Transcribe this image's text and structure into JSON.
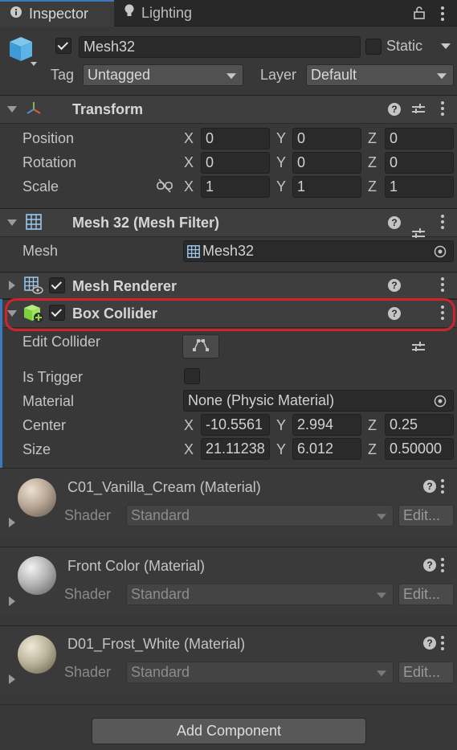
{
  "tabs": [
    {
      "label": "Inspector",
      "icon": "info-icon"
    },
    {
      "label": "Lighting",
      "icon": "bulb-icon"
    }
  ],
  "object": {
    "name": "Mesh32",
    "active": true,
    "static_label": "Static",
    "static_checked": false,
    "tag_label": "Tag",
    "tag_value": "Untagged",
    "layer_label": "Layer",
    "layer_value": "Default"
  },
  "transform": {
    "title": "Transform",
    "rows": [
      {
        "label": "Position",
        "x": "0",
        "y": "0",
        "z": "0"
      },
      {
        "label": "Rotation",
        "x": "0",
        "y": "0",
        "z": "0"
      },
      {
        "label": "Scale",
        "x": "1",
        "y": "1",
        "z": "1"
      }
    ]
  },
  "mesh_filter": {
    "title": "Mesh 32 (Mesh Filter)",
    "mesh_label": "Mesh",
    "mesh_value": "Mesh32"
  },
  "mesh_renderer": {
    "title": "Mesh Renderer",
    "enabled": true
  },
  "box_collider": {
    "title": "Box Collider",
    "enabled": true,
    "edit_collider_label": "Edit Collider",
    "is_trigger_label": "Is Trigger",
    "material_label": "Material",
    "material_value": "None (Physic Material)",
    "center_label": "Center",
    "center": {
      "x": "-10.5561",
      "y": "2.994",
      "z": "0.25"
    },
    "size_label": "Size",
    "size": {
      "x": "21.11238",
      "y": "6.012",
      "z": "0.50000"
    }
  },
  "axis_labels": {
    "x": "X",
    "y": "Y",
    "z": "Z"
  },
  "materials": [
    {
      "name": "C01_Vanilla_Cream (Material)",
      "shader_label": "Shader",
      "shader": "Standard",
      "edit_label": "Edit...",
      "color": "#b9a796"
    },
    {
      "name": "Front Color (Material)",
      "shader_label": "Shader",
      "shader": "Standard",
      "edit_label": "Edit...",
      "color": "#b5b5b5"
    },
    {
      "name": "D01_Frost_White (Material)",
      "shader_label": "Shader",
      "shader": "Standard",
      "edit_label": "Edit...",
      "color": "#bdb59b"
    }
  ],
  "add_component_label": "Add Component",
  "colors": {
    "background": "#383838",
    "header": "#3e3e3e",
    "accent": "#3a79bb",
    "highlight": "#d0242b"
  }
}
